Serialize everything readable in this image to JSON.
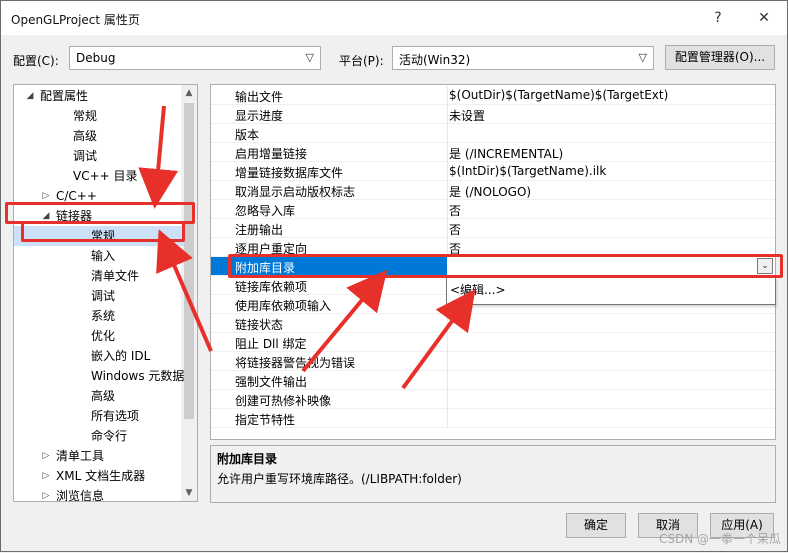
{
  "window": {
    "title": "OpenGLProject 属性页",
    "help": "?",
    "close": "✕"
  },
  "config": {
    "label": "配置(C):",
    "value": "Debug"
  },
  "platform": {
    "label": "平台(P):",
    "value": "活动(Win32)"
  },
  "config_manager_label": "配置管理器(O)...",
  "tree": [
    {
      "label": "配置属性",
      "twist": "◢"
    },
    {
      "label": "常规"
    },
    {
      "label": "高级"
    },
    {
      "label": "调试"
    },
    {
      "label": "VC++ 目录"
    },
    {
      "label": "C/C++",
      "twist": "▷"
    },
    {
      "label": "链接器",
      "twist": "◢"
    },
    {
      "label": "常规",
      "selected": true
    },
    {
      "label": "输入"
    },
    {
      "label": "清单文件"
    },
    {
      "label": "调试"
    },
    {
      "label": "系统"
    },
    {
      "label": "优化"
    },
    {
      "label": "嵌入的 IDL"
    },
    {
      "label": "Windows 元数据"
    },
    {
      "label": "高级"
    },
    {
      "label": "所有选项"
    },
    {
      "label": "命令行"
    },
    {
      "label": "清单工具",
      "twist": "▷"
    },
    {
      "label": "XML 文档生成器",
      "twist": "▷"
    },
    {
      "label": "浏览信息",
      "twist": "▷"
    }
  ],
  "properties": [
    {
      "key": "输出文件",
      "value": "$(OutDir)$(TargetName)$(TargetExt)"
    },
    {
      "key": "显示进度",
      "value": "未设置"
    },
    {
      "key": "版本",
      "value": ""
    },
    {
      "key": "启用增量链接",
      "value": "是 (/INCREMENTAL)"
    },
    {
      "key": "增量链接数据库文件",
      "value": "$(IntDir)$(TargetName).ilk"
    },
    {
      "key": "取消显示启动版权标志",
      "value": "是 (/NOLOGO)"
    },
    {
      "key": "忽略导入库",
      "value": "否"
    },
    {
      "key": "注册输出",
      "value": "否"
    },
    {
      "key": "逐用户重定向",
      "value": "否"
    },
    {
      "key": "附加库目录",
      "value": "",
      "highlighted": true
    },
    {
      "key": "链接库依赖项",
      "value": ""
    },
    {
      "key": "使用库依赖项输入",
      "value": ""
    },
    {
      "key": "链接状态",
      "value": ""
    },
    {
      "key": "阻止 Dll 绑定",
      "value": ""
    },
    {
      "key": "将链接器警告视为错误",
      "value": ""
    },
    {
      "key": "强制文件输出",
      "value": ""
    },
    {
      "key": "创建可热修补映像",
      "value": ""
    },
    {
      "key": "指定节特性",
      "value": ""
    }
  ],
  "dropdown_option": "<编辑...>",
  "description": {
    "title": "附加库目录",
    "text": "允许用户重写环境库路径。(/LIBPATH:folder)"
  },
  "buttons": {
    "ok": "确定",
    "cancel": "取消",
    "apply": "应用(A)"
  },
  "watermark": "CSDN @一拳一个呆瓜",
  "colors": {
    "selection": "#0078d7",
    "annotation": "#e8302a"
  }
}
